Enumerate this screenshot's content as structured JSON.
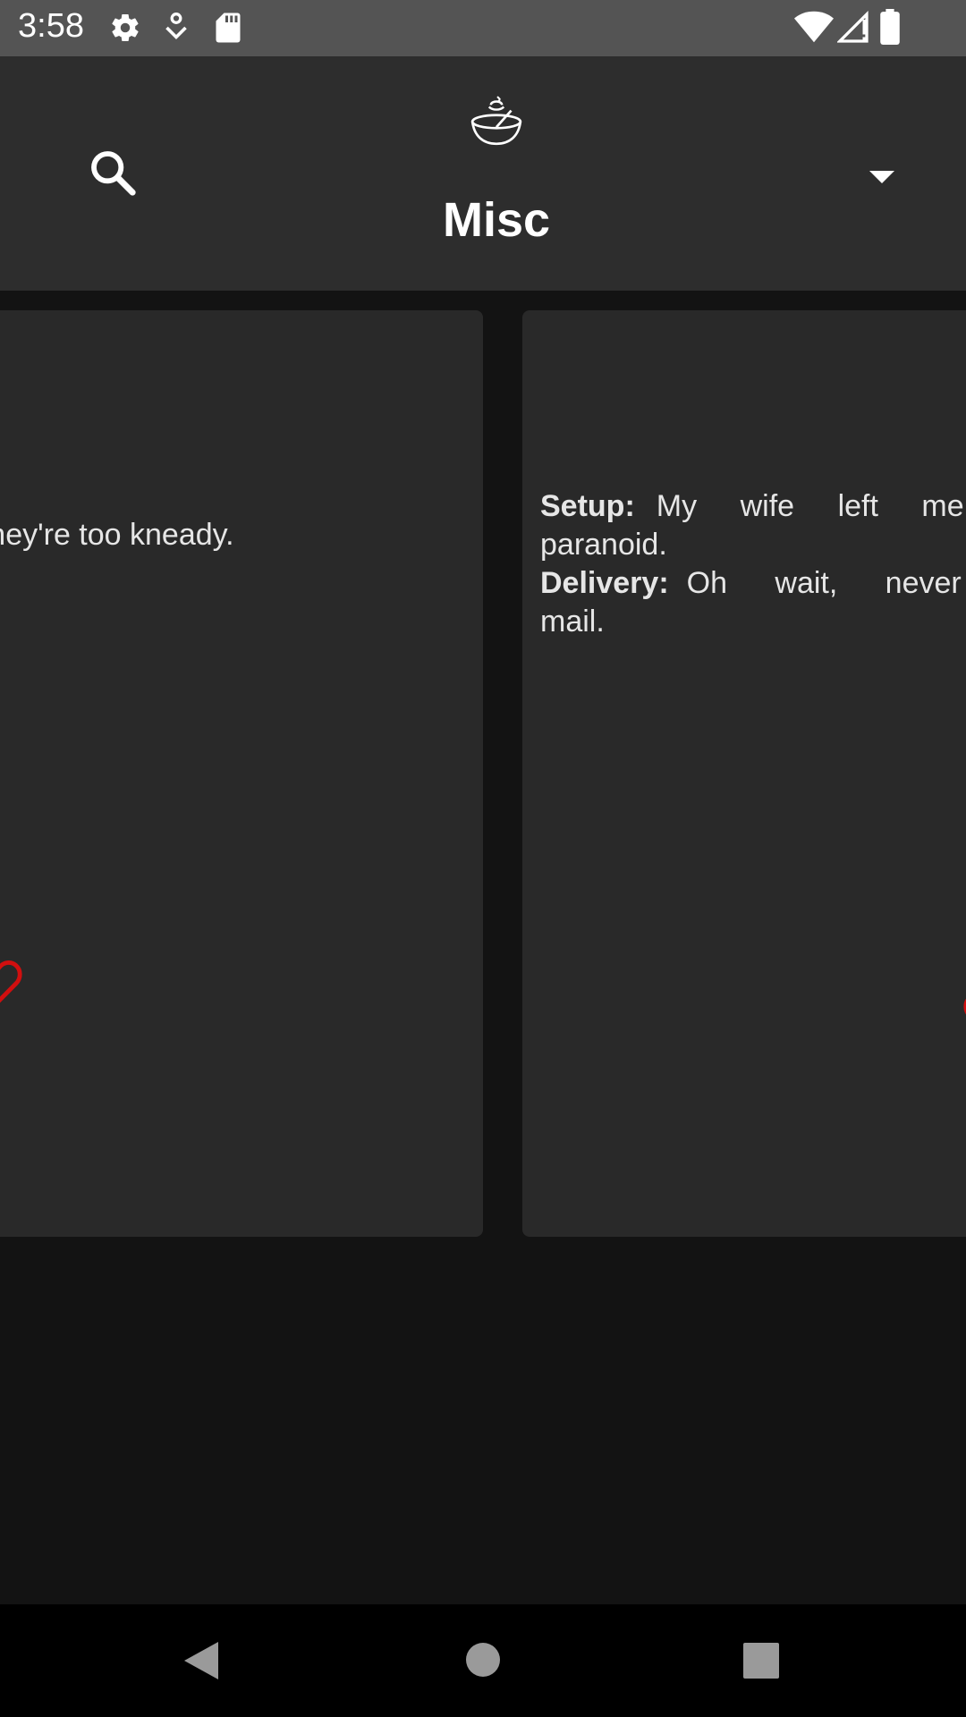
{
  "status_bar": {
    "time": "3:58",
    "icons": [
      "settings-icon",
      "location-icon",
      "sd-card-icon",
      "wifi-icon",
      "signal-icon",
      "battery-icon"
    ]
  },
  "app_bar": {
    "title": "Misc",
    "icons": [
      "search-icon",
      "bowl-logo-icon",
      "dropdown-arrow-icon"
    ]
  },
  "cards": [
    {
      "type": "single",
      "text": "aker. They're too kneady.",
      "favorite_icon": "heart-outline-icon"
    },
    {
      "type": "twopart",
      "setup_label": "Setup:",
      "setup_text": "My wife left me be",
      "setup_cont": "paranoid.",
      "delivery_label": "Delivery:",
      "delivery_text": "Oh wait, never mi",
      "delivery_cont": "mail.",
      "favorite_icon": "heart-outline-icon"
    }
  ],
  "colors": {
    "status_bar": "#545454",
    "app_bar": "#2d2d2d",
    "background": "#131313",
    "card": "#292929",
    "heart": "#d10f0f",
    "nav_bar": "#000000"
  },
  "nav": [
    "back-icon",
    "home-icon",
    "recents-icon"
  ]
}
